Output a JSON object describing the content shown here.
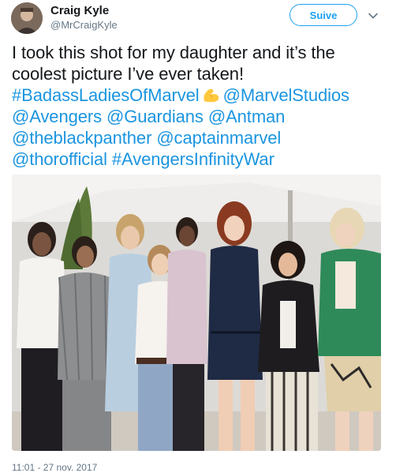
{
  "author": {
    "name": "Craig Kyle",
    "handle": "@MrCraigKyle"
  },
  "follow_button_label": "Suive",
  "tweet": {
    "line1": "I took this shot for my daughter and it’s the",
    "line2_text": "coolest picture I’ve ever taken!",
    "line3_tag1": "#BadassLadiesOfMarvel",
    "line3_tag2": "@MarvelStudios",
    "line4_tag1": "@Avengers",
    "line4_tag2": "@Guardians",
    "line4_tag3": "@Antman",
    "line5_tag1": "@theblackpanther",
    "line5_tag2": "@captainmarvel",
    "line6_tag1": "@thorofficial",
    "line6_tag2": "#AvengersInfinityWar"
  },
  "timestamp": "11:01 - 27 nov. 2017",
  "colors": {
    "link": "#1b95e0",
    "follow": "#1da1f2",
    "text": "#14171a",
    "muted": "#657786"
  },
  "icons": {
    "emoji": "flexed-biceps-emoji",
    "menu": "chevron-down-icon"
  }
}
